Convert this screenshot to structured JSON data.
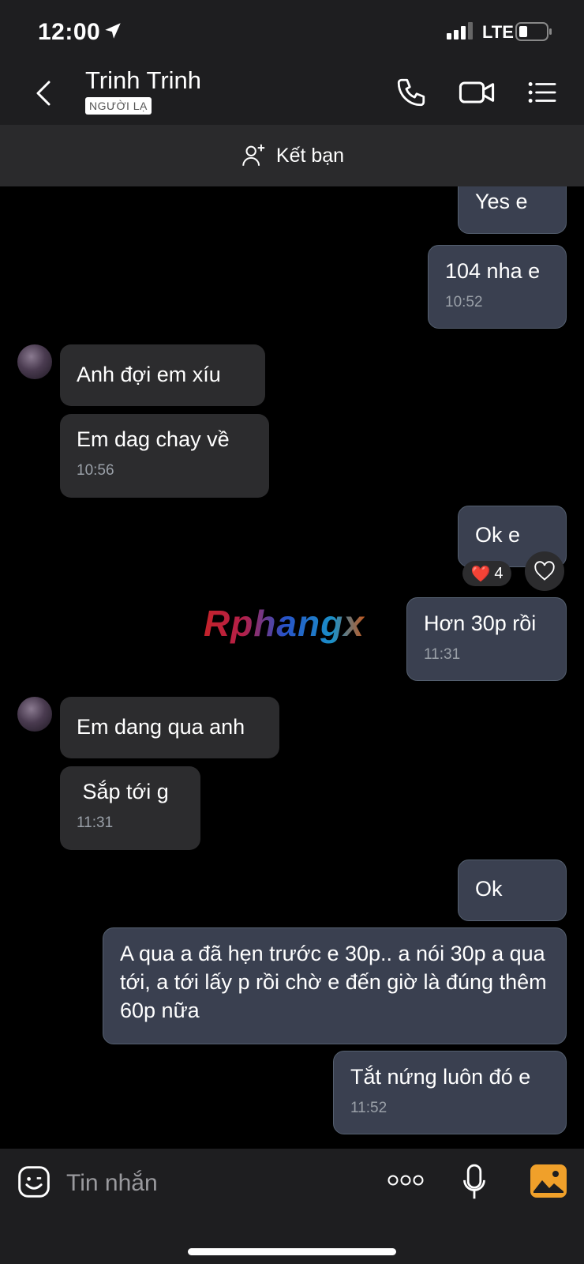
{
  "status_bar": {
    "time": "12:00",
    "network": "LTE"
  },
  "header": {
    "contact_name": "Trinh Trinh",
    "badge": "NGƯỜI LẠ"
  },
  "friend_bar": {
    "label": "Kết bạn"
  },
  "messages": [
    {
      "text": "Yes e"
    },
    {
      "text": "104 nha e",
      "time": "10:52"
    },
    {
      "text": "Anh  đợi em xíu"
    },
    {
      "text": "Em dag chay về",
      "time": "10:56"
    },
    {
      "text": "Ok e"
    },
    {
      "text": "Hơn 30p rồi",
      "time": "11:31"
    },
    {
      "text": "Em dang qua anh"
    },
    {
      "text": " Sắp tới g",
      "time": "11:31"
    },
    {
      "text": "Ok"
    },
    {
      "text": "A qua a đã hẹn trước e 30p.. a nói 30p a qua tới, a tới lấy p rồi chờ e đến giờ là đúng thêm 60p nữa"
    },
    {
      "text": "Tắt nứng luôn đó e",
      "time": "11:52"
    }
  ],
  "reaction": {
    "emoji": "❤️",
    "count": "4"
  },
  "watermark": "Rphangx",
  "input": {
    "placeholder": "Tin nhắn"
  },
  "colors": {
    "bubble_me": "#3a4050",
    "bubble_them": "#2c2c2e",
    "bar": "#1e1e20"
  }
}
